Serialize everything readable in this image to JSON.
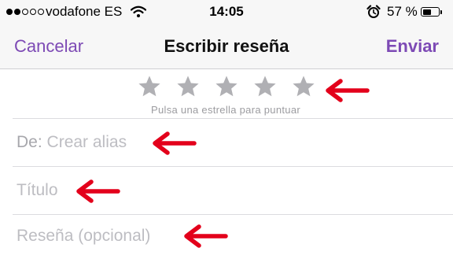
{
  "status_bar": {
    "carrier": "vodafone ES",
    "time": "14:05",
    "battery_percent": "57 %",
    "battery_level": 0.57,
    "signal_bars_filled": 2,
    "signal_bars_total": 5,
    "icons": [
      "wifi-icon",
      "alarm-icon",
      "battery-icon"
    ]
  },
  "nav": {
    "cancel_label": "Cancelar",
    "title": "Escribir reseña",
    "send_label": "Enviar"
  },
  "rating": {
    "star_count": 5,
    "selected": 0,
    "hint": "Pulsa una estrella para puntuar"
  },
  "form": {
    "author_label": "De:",
    "author_placeholder": "Crear alias",
    "title_placeholder": "Título",
    "review_placeholder": "Reseña (opcional)"
  },
  "colors": {
    "accent": "#7d4ab5",
    "annotation_arrow": "#e3001b",
    "star_empty": "#b0b0b4",
    "placeholder": "#b7b7bc"
  }
}
